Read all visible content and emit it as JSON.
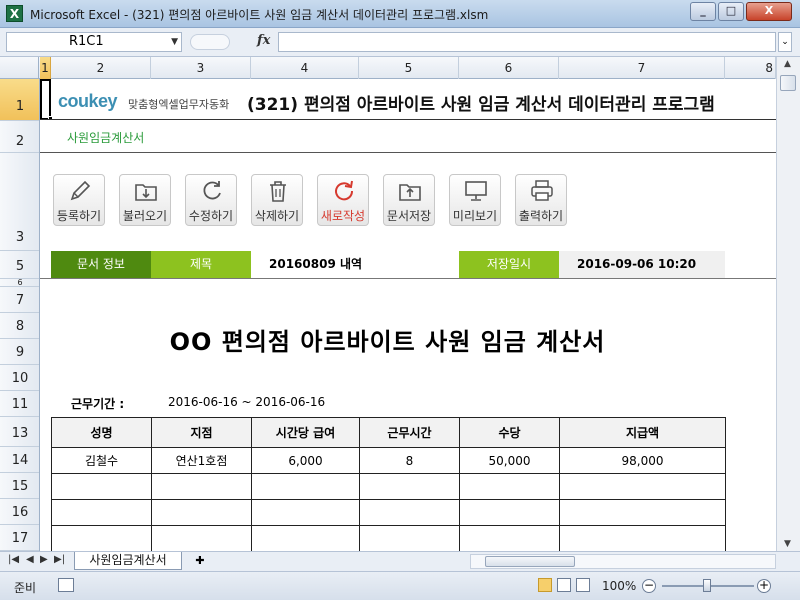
{
  "window": {
    "app_icon": "excel-icon",
    "title": "Microsoft Excel - (321) 편의점 아르바이트 사원 임금 계산서 데이터관리 프로그램.xlsm",
    "controls": [
      "_",
      "□",
      "X"
    ]
  },
  "formula_bar": {
    "name_box": "R1C1",
    "fx": "fx",
    "formula": ""
  },
  "columns": [
    "1",
    "2",
    "3",
    "4",
    "5",
    "6",
    "7",
    "8"
  ],
  "rows": [
    "1",
    "2",
    "3",
    "5",
    "6",
    "7",
    "8",
    "9",
    "10",
    "11",
    "13",
    "14",
    "15",
    "16",
    "17"
  ],
  "sheet": {
    "brand": "coukey",
    "brand_sub": "맞춤형엑셀업무자동화",
    "header_title": "(321) 편의점 아르바이트 사원 임금 계산서 데이터관리 프로그램",
    "subtitle": "사원임금계산서",
    "buttons": [
      {
        "label": "등록하기",
        "icon": "pencil-icon"
      },
      {
        "label": "불러오기",
        "icon": "folder-open-icon"
      },
      {
        "label": "수정하기",
        "icon": "refresh-icon"
      },
      {
        "label": "삭제하기",
        "icon": "trash-icon"
      },
      {
        "label": "새로작성",
        "icon": "new-doc-icon",
        "accent": "#d63a2f"
      },
      {
        "label": "문서저장",
        "icon": "folder-save-icon"
      },
      {
        "label": "미리보기",
        "icon": "monitor-icon"
      },
      {
        "label": "출력하기",
        "icon": "printer-icon"
      }
    ],
    "info": {
      "doc_info_label": "문서 정보",
      "title_label": "제목",
      "title_value": "20160809 내역",
      "saved_label": "저장일시",
      "saved_value": "2016-09-06 10:20"
    },
    "report_title": "OO 편의점 아르바이트 사원 임금 계산서",
    "period_label": "근무기간 :",
    "period_value": "2016-06-16 ~ 2016-06-16",
    "table": {
      "headers": [
        "성명",
        "지점",
        "시간당 급여",
        "근무시간",
        "수당",
        "지급액"
      ],
      "rows": [
        [
          "김철수",
          "연산1호점",
          "6,000",
          "8",
          "50,000",
          "98,000"
        ],
        [
          "",
          "",
          "",
          "",
          "",
          ""
        ],
        [
          "",
          "",
          "",
          "",
          "",
          ""
        ],
        [
          "",
          "",
          "",
          "",
          "",
          ""
        ]
      ]
    },
    "colors": {
      "green_dark": "#4f8a10",
      "green_light": "#8dc21f",
      "subtitle_green": "#2a9b3a",
      "accent_red": "#d63a2f"
    }
  },
  "tabs": {
    "sheet_name": "사원임금계산서"
  },
  "status": {
    "mode": "준비",
    "zoom": "100%"
  }
}
